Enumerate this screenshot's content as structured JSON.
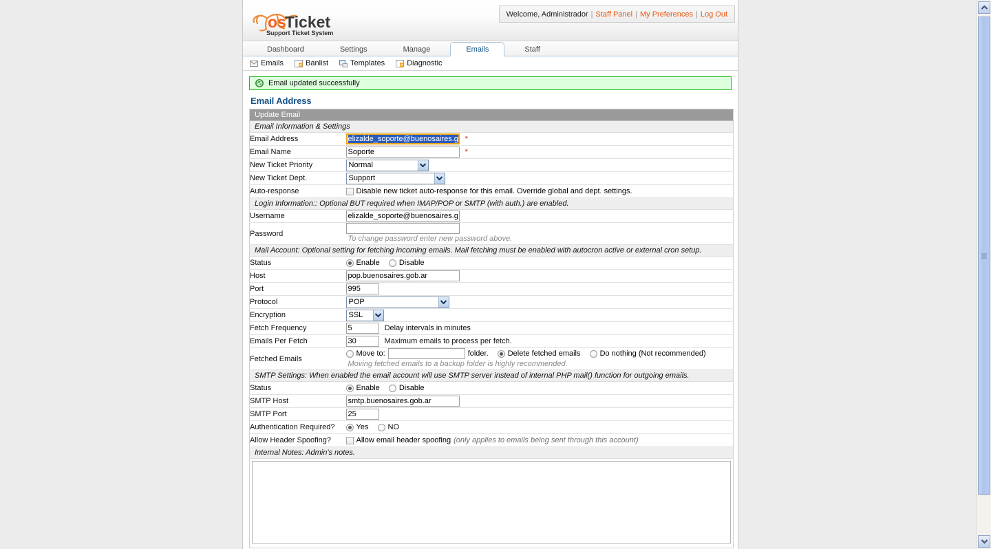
{
  "header": {
    "logo_text": "osTicket",
    "logo_tagline": "Support Ticket System",
    "welcome": "Welcome, Administrador",
    "links": [
      "Staff Panel",
      "My Preferences",
      "Log Out"
    ],
    "separator": "|"
  },
  "tabs": [
    {
      "label": "Dashboard",
      "active": false
    },
    {
      "label": "Settings",
      "active": false
    },
    {
      "label": "Manage",
      "active": false
    },
    {
      "label": "Emails",
      "active": true
    },
    {
      "label": "Staff",
      "active": false
    }
  ],
  "subnav": [
    {
      "label": "Emails",
      "icon": "envelope-icon"
    },
    {
      "label": "Banlist",
      "icon": "banlist-icon"
    },
    {
      "label": "Templates",
      "icon": "templates-icon"
    },
    {
      "label": "Diagnostic",
      "icon": "diagnostic-icon"
    }
  ],
  "alert": {
    "icon": "success-check-icon",
    "message": "Email updated successfully"
  },
  "page_title": "Email Address",
  "form": {
    "table_header": "Update Email",
    "sections": {
      "info": "Email Information & Settings",
      "login": "Login Information:: Optional BUT required when IMAP/POP or SMTP (with auth.) are enabled.",
      "mail_account": "Mail Account: Optional setting for fetching incoming emails. Mail fetching must be enabled with autocron active or external cron setup.",
      "smtp": "SMTP Settings: When enabled the email account will use SMTP server instead of internal PHP mail() function for outgoing emails.",
      "internal_notes": "Internal Notes: Admin's notes."
    },
    "labels": {
      "email_address": "Email Address",
      "email_name": "Email Name",
      "new_ticket_priority": "New Ticket Priority",
      "new_ticket_dept": "New Ticket Dept.",
      "auto_response": "Auto-response",
      "username": "Username",
      "password": "Password",
      "status": "Status",
      "host": "Host",
      "port": "Port",
      "protocol": "Protocol",
      "encryption": "Encryption",
      "fetch_frequency": "Fetch Frequency",
      "emails_per_fetch": "Emails Per Fetch",
      "fetched_emails": "Fetched Emails",
      "smtp_status": "Status",
      "smtp_host": "SMTP Host",
      "smtp_port": "SMTP Port",
      "auth_required": "Authentication Required?",
      "header_spoofing": "Allow Header Spoofing?"
    },
    "values": {
      "email_address": "elizalde_soporte@buenosaires.gob",
      "email_name": "Soporte",
      "new_ticket_priority": "Normal",
      "new_ticket_dept": "Support",
      "username": "elizalde_soporte@buenosaires.gob",
      "password": "",
      "host": "pop.buenosaires.gob.ar",
      "port": "995",
      "protocol": "POP",
      "encryption": "SSL",
      "fetch_frequency": "5",
      "emails_per_fetch": "30",
      "move_to_folder": "",
      "smtp_host": "smtp.buenosaires.gob.ar",
      "smtp_port": "25",
      "internal_notes": ""
    },
    "texts": {
      "required_marker": "*",
      "auto_response_option": "Disable new ticket auto-response for this email. Override global and dept. settings.",
      "password_hint": "To change password enter new password above.",
      "status_enable": "Enable",
      "status_disable": "Disable",
      "fetch_frequency_hint": "Delay intervals in minutes",
      "emails_per_fetch_hint": "Maximum emails to process per fetch.",
      "move_to": "Move to:",
      "folder_suffix": "folder.",
      "delete_fetched": "Delete fetched emails",
      "do_nothing": "Do nothing (Not recommended)",
      "fetched_hint": "Moving fetched emails to a backup folder is highly recommended.",
      "auth_yes": "Yes",
      "auth_no": "NO",
      "spoofing_label": "Allow email header spoofing",
      "spoofing_hint": "(only applies to emails being sent through this account)"
    },
    "states": {
      "email_address_focused": true,
      "email_address_selected": true,
      "auto_response_checked": false,
      "mail_status": "Enable",
      "fetched_emails_choice": "Delete fetched emails",
      "smtp_status": "Enable",
      "auth_required": "Yes",
      "header_spoofing_checked": false
    }
  },
  "scrollbar": {
    "up_icon": "chevron-up-icon",
    "down_icon": "chevron-down-icon",
    "thumb": "vertical-scroll-thumb"
  },
  "colors": {
    "brand_orange": "#e8540c",
    "title_blue": "#15538a",
    "alert_bg": "#ddffdd",
    "alert_border": "#22bb22",
    "header_gray": "#9a9a9a",
    "section_gray": "#eeeeee",
    "focus_ring": "#e8a317",
    "selection_blue": "#2a5cbd"
  }
}
